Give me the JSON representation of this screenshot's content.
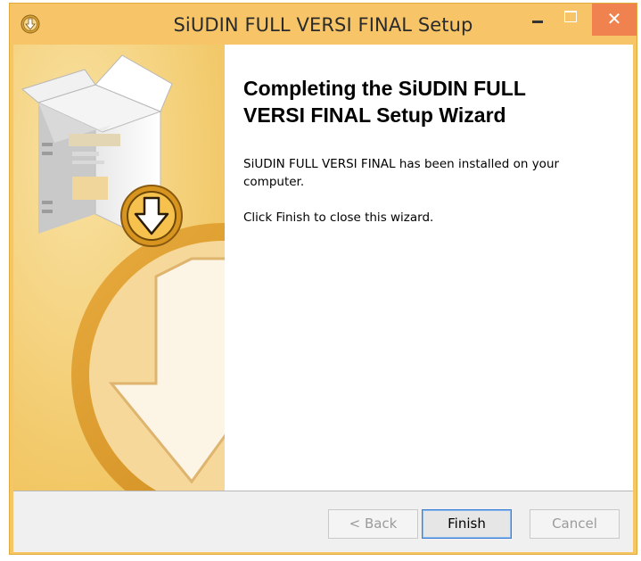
{
  "window": {
    "title": "SiUDIN FULL VERSI FINAL Setup",
    "controls": {
      "close_glyph": "✕"
    }
  },
  "wizard": {
    "heading_line1": "Completing the SiUDIN FULL",
    "heading_line2": "VERSI FINAL Setup Wizard",
    "installed_line1": "SiUDIN FULL VERSI FINAL has been installed on your",
    "installed_line2": "computer.",
    "finish_hint": "Click Finish to close this wizard."
  },
  "buttons": {
    "back_label": "< Back",
    "finish_label": "Finish",
    "cancel_label": "Cancel"
  },
  "colors": {
    "side_panel": "#f4d27c",
    "titlebar": "#f7c567",
    "close_button": "#f0824f",
    "finish_border": "#3c7fd8"
  },
  "icons": {
    "app": "download-arrow-icon",
    "side_art": "box-with-download-arrow-icon"
  }
}
